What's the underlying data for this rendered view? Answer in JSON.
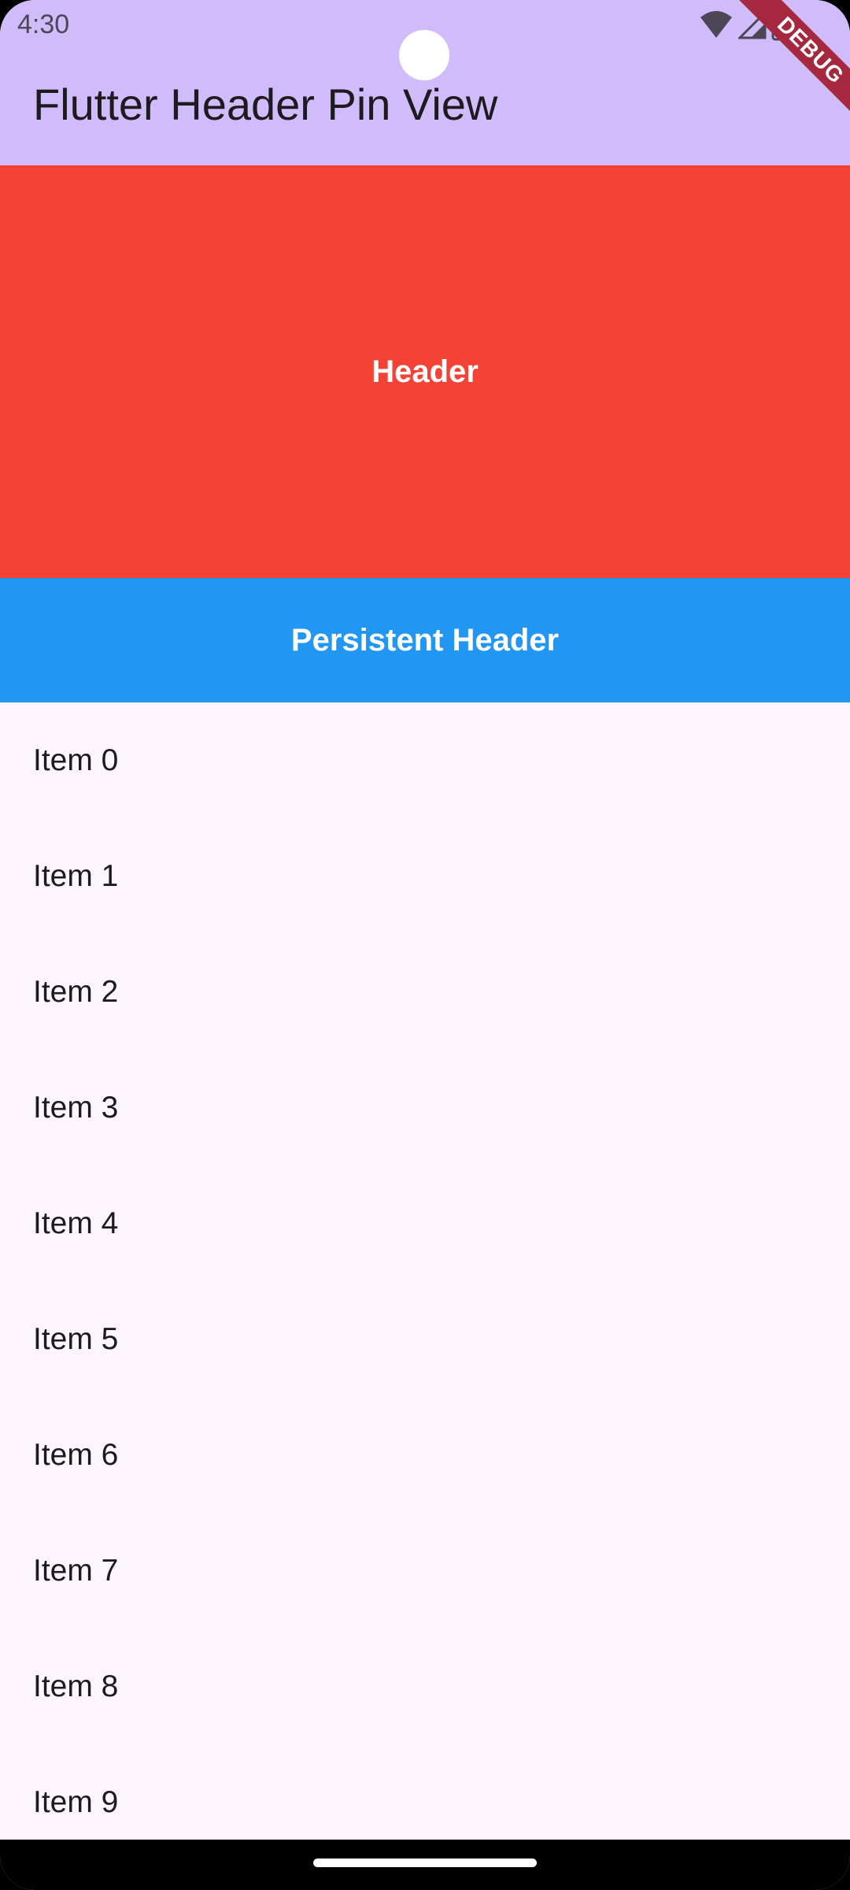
{
  "status_bar": {
    "time": "4:30",
    "icons": [
      "wifi-icon",
      "cell-signal-icon",
      "battery-icon"
    ]
  },
  "app_bar": {
    "title": "Flutter Header Pin View",
    "background_color": "#d1bcfb"
  },
  "debug_banner": {
    "label": "DEBUG",
    "color": "#a6283e"
  },
  "header": {
    "label": "Header",
    "color": "#f44336"
  },
  "persistent_header": {
    "label": "Persistent Header",
    "color": "#2196f3"
  },
  "list": {
    "items": [
      {
        "label": "Item 0"
      },
      {
        "label": "Item 1"
      },
      {
        "label": "Item 2"
      },
      {
        "label": "Item 3"
      },
      {
        "label": "Item 4"
      },
      {
        "label": "Item 5"
      },
      {
        "label": "Item 6"
      },
      {
        "label": "Item 7"
      },
      {
        "label": "Item 8"
      },
      {
        "label": "Item 9"
      }
    ]
  }
}
